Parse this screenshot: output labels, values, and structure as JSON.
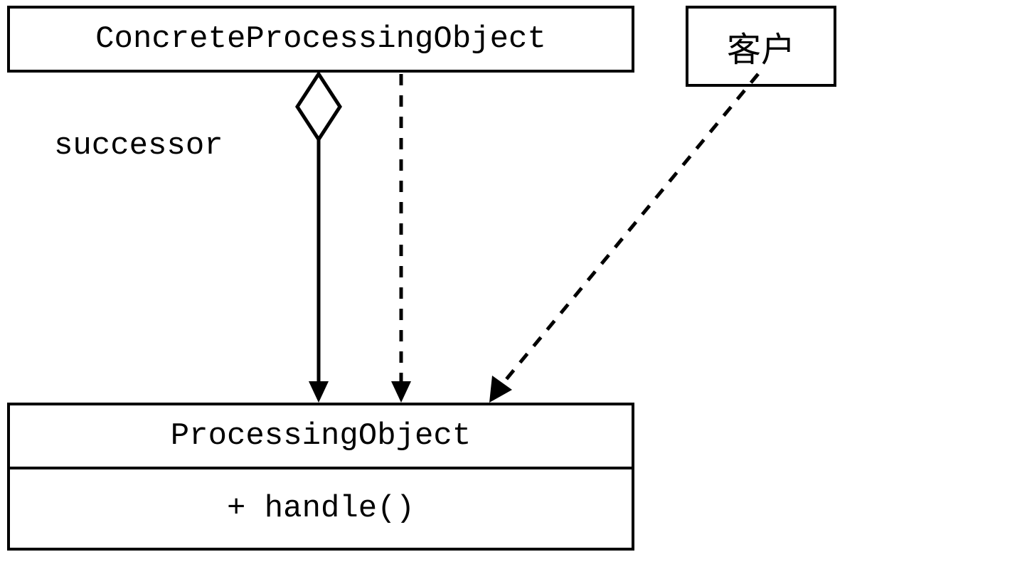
{
  "boxes": {
    "concreteProcessing": {
      "title": "ConcreteProcessingObject"
    },
    "client": {
      "title": "客户"
    },
    "processingObject": {
      "title": "ProcessingObject",
      "method": "+ handle()"
    }
  },
  "relations": {
    "aggregation": {
      "label": "successor"
    }
  }
}
